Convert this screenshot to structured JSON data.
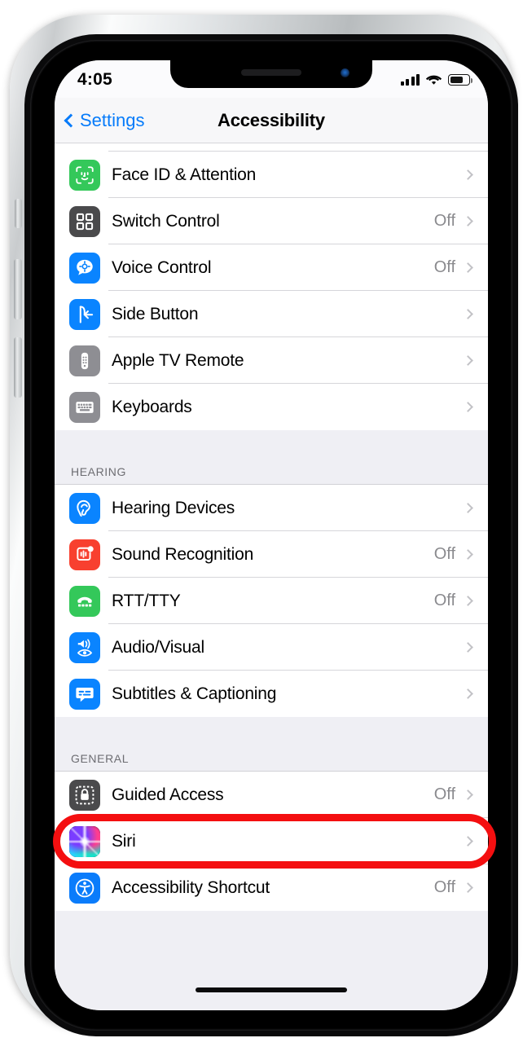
{
  "device": {
    "frame": "iphone-silver",
    "accent_blue": "#067bfa",
    "annotation_color": "#f40f10"
  },
  "status_bar": {
    "time": "4:05",
    "signal_bars": 4,
    "wifi": "wifi-icon",
    "battery_level": 60
  },
  "nav": {
    "back_label": "Settings",
    "title": "Accessibility"
  },
  "sections": [
    {
      "header": "",
      "rows": [
        {
          "label": "Face ID & Attention",
          "value": "",
          "icon": "face-id-icon",
          "icon_class": "ic-faceid"
        },
        {
          "label": "Switch Control",
          "value": "Off",
          "icon": "switch-control-icon",
          "icon_class": "ic-switch"
        },
        {
          "label": "Voice Control",
          "value": "Off",
          "icon": "voice-control-icon",
          "icon_class": "ic-voice"
        },
        {
          "label": "Side Button",
          "value": "",
          "icon": "side-button-icon",
          "icon_class": "ic-side"
        },
        {
          "label": "Apple TV Remote",
          "value": "",
          "icon": "apple-tv-remote-icon",
          "icon_class": "ic-tvrem"
        },
        {
          "label": "Keyboards",
          "value": "",
          "icon": "keyboard-icon",
          "icon_class": "ic-keyb"
        }
      ]
    },
    {
      "header": "HEARING",
      "rows": [
        {
          "label": "Hearing Devices",
          "value": "",
          "icon": "ear-icon",
          "icon_class": "ic-hearing"
        },
        {
          "label": "Sound Recognition",
          "value": "Off",
          "icon": "sound-recognition-icon",
          "icon_class": "ic-sound"
        },
        {
          "label": "RTT/TTY",
          "value": "Off",
          "icon": "rtt-tty-icon",
          "icon_class": "ic-rtt"
        },
        {
          "label": "Audio/Visual",
          "value": "",
          "icon": "audio-visual-icon",
          "icon_class": "ic-av"
        },
        {
          "label": "Subtitles & Captioning",
          "value": "",
          "icon": "subtitles-icon",
          "icon_class": "ic-subs"
        }
      ]
    },
    {
      "header": "GENERAL",
      "rows": [
        {
          "label": "Guided Access",
          "value": "Off",
          "icon": "guided-access-lock-icon",
          "icon_class": "ic-guided"
        },
        {
          "label": "Siri",
          "value": "",
          "icon": "siri-icon",
          "icon_class": "ic-siri",
          "highlighted": true
        },
        {
          "label": "Accessibility Shortcut",
          "value": "Off",
          "icon": "accessibility-person-icon",
          "icon_class": "ic-short"
        }
      ]
    }
  ]
}
